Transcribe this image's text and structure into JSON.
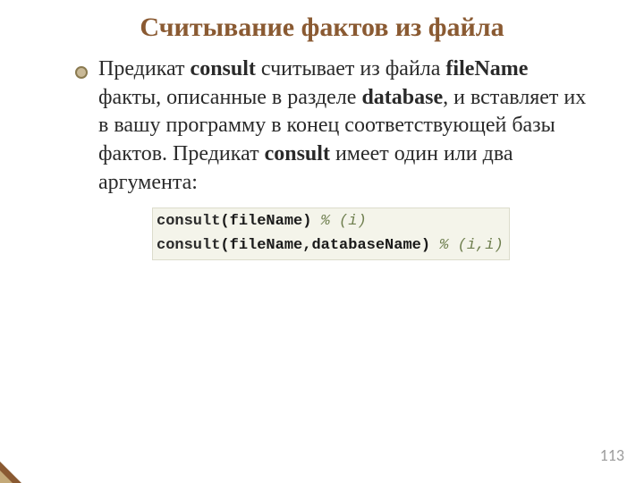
{
  "title": "Считывание фактов из файла",
  "paragraph": {
    "p1": "Предикат ",
    "b1": "consult",
    "p2": " считывает из файла ",
    "b2": "fileName",
    "p3": " факты, описанные в разделе ",
    "b3": "database",
    "p4": ", и вставляет их в вашу программу в конец соответствующей базы фактов. Предикат ",
    "b4": "consult",
    "p5": " имеет один или два аргумента:"
  },
  "code": {
    "l1_kw": "consult",
    "l1_args": "(fileName)",
    "l1_comment": " % (i)",
    "l2_kw": "consult",
    "l2_args": "(fileName,databaseName)",
    "l2_comment": " % (i,i)"
  },
  "page_number": "113"
}
